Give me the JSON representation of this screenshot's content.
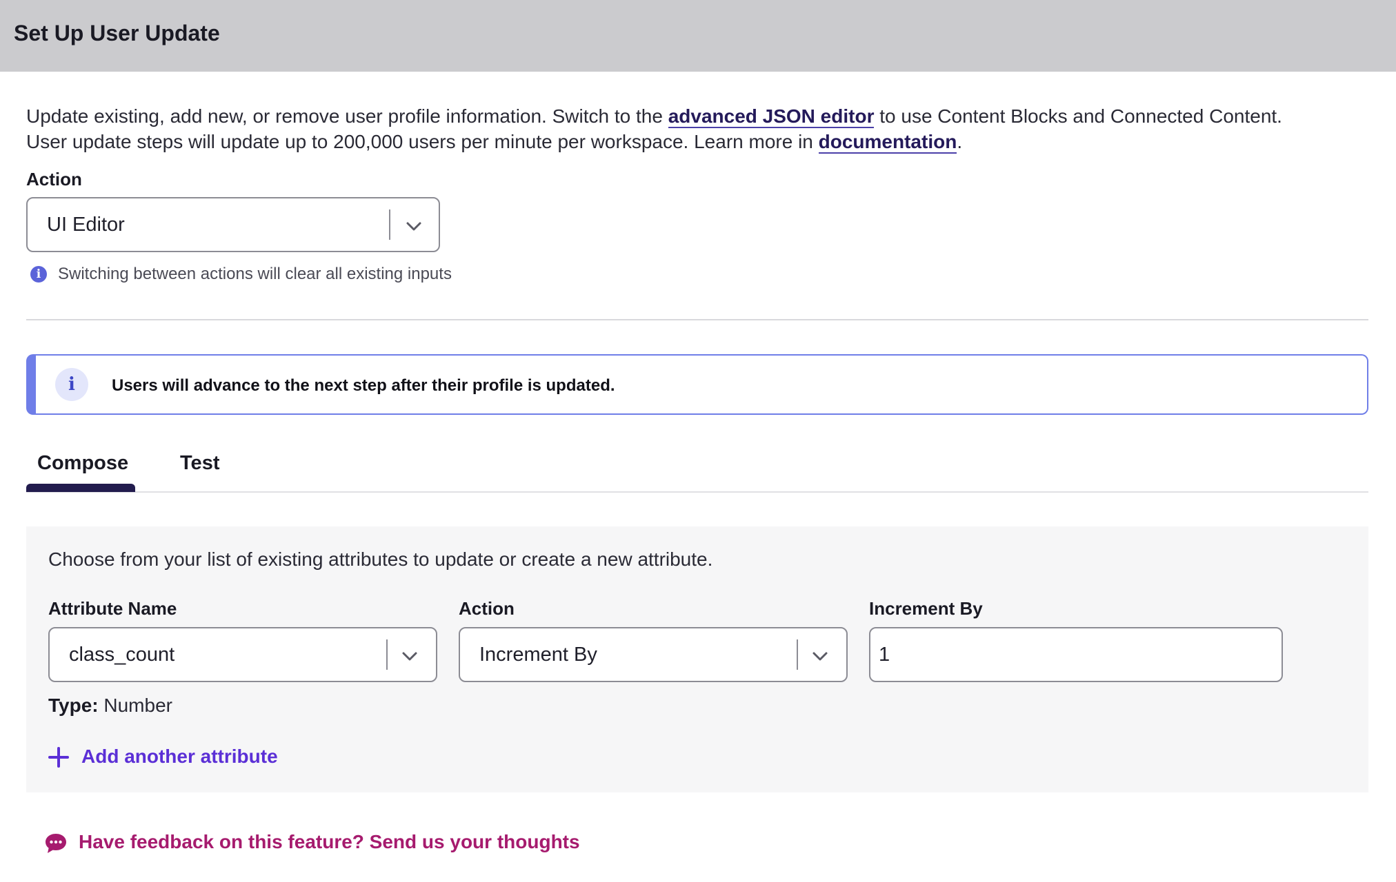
{
  "header": {
    "title": "Set Up User Update"
  },
  "intro": {
    "line1_before": "Update existing, add new, or remove user profile information. Switch to the ",
    "json_editor_link": "advanced JSON editor",
    "line1_after": " to use Content Blocks and Connected Content.",
    "line2_before": "User update steps will update up to 200,000 users per minute per workspace. Learn more in ",
    "documentation_link": "documentation",
    "line2_after": "."
  },
  "action_select": {
    "label": "Action",
    "value": "UI Editor",
    "hint": "Switching between actions will clear all existing inputs"
  },
  "callout": {
    "text": "Users will advance to the next step after their profile is updated."
  },
  "tabs": [
    {
      "label": "Compose",
      "active": true
    },
    {
      "label": "Test",
      "active": false
    }
  ],
  "compose": {
    "description": "Choose from your list of existing attributes to update or create a new attribute.",
    "attribute_name": {
      "label": "Attribute Name",
      "value": "class_count"
    },
    "attribute_action": {
      "label": "Action",
      "value": "Increment By"
    },
    "increment_by": {
      "label": "Increment By",
      "value": "1"
    },
    "type_label": "Type:",
    "type_value": "Number",
    "add_attribute": "Add another attribute"
  },
  "feedback": {
    "text": "Have feedback on this feature? Send us your thoughts"
  },
  "colors": {
    "header_bg": "#cbcbce",
    "link": "#241a5a",
    "callout_border": "#6f7ee8",
    "tab_active": "#221c4e",
    "add_link": "#5b2fd6",
    "feedback": "#a61b6e"
  },
  "icons": {
    "chevron": "chevron-down-icon",
    "info": "info-icon",
    "plus": "plus-icon",
    "feedback": "chat-bubble-icon"
  }
}
